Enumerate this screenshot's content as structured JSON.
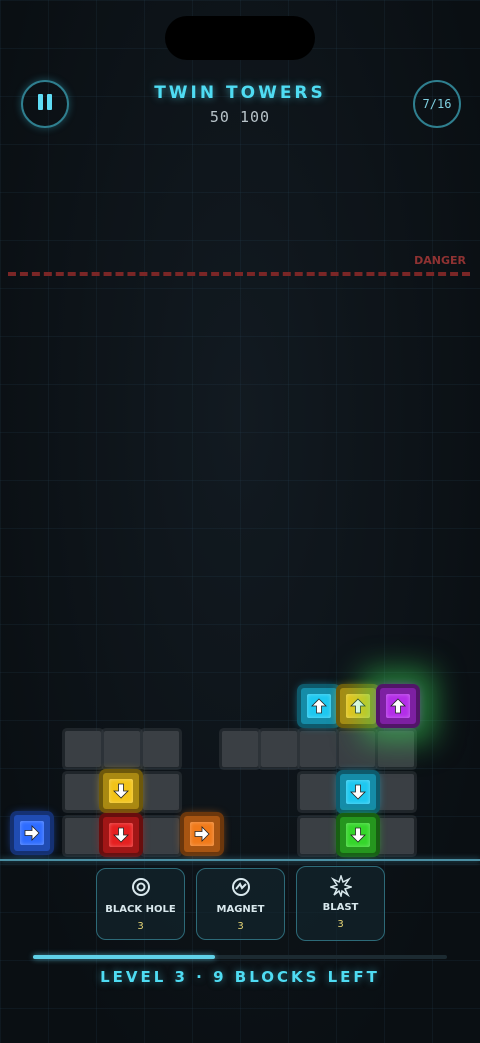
{
  "header": {
    "title": "TWIN TOWERS",
    "score": "50 100",
    "level_progress": "7/16"
  },
  "danger": {
    "label": "DANGER"
  },
  "powerups": [
    {
      "label": "BLACK HOLE",
      "count": "3",
      "icon": "black-hole-icon"
    },
    {
      "label": "MAGNET",
      "count": "3",
      "icon": "magnet-icon"
    },
    {
      "label": "BLAST",
      "count": "3",
      "icon": "blast-icon"
    }
  ],
  "footer": {
    "status": "LEVEL 3 · 9 BLOCKS LEFT",
    "progress_fraction": 0.44
  },
  "board": {
    "blocks": [
      {
        "color": "blue",
        "direction": "right"
      },
      {
        "color": "yellow",
        "direction": "down"
      },
      {
        "color": "red",
        "direction": "down"
      },
      {
        "color": "orange",
        "direction": "right"
      },
      {
        "color": "cyan",
        "direction": "up"
      },
      {
        "color": "yellow",
        "direction": "up"
      },
      {
        "color": "purple",
        "direction": "up",
        "highlighted": true
      },
      {
        "color": "cyan",
        "direction": "down"
      },
      {
        "color": "green",
        "direction": "down"
      }
    ]
  },
  "colors": {
    "accent": "#4fdcf3",
    "danger": "#8f3232",
    "blue": "#2e6cff",
    "yellow": "#f2c319",
    "red": "#e62020",
    "orange": "#f07a1a",
    "cyan": "#1ec8f0",
    "purple": "#b32ee8",
    "green": "#35d62b"
  }
}
